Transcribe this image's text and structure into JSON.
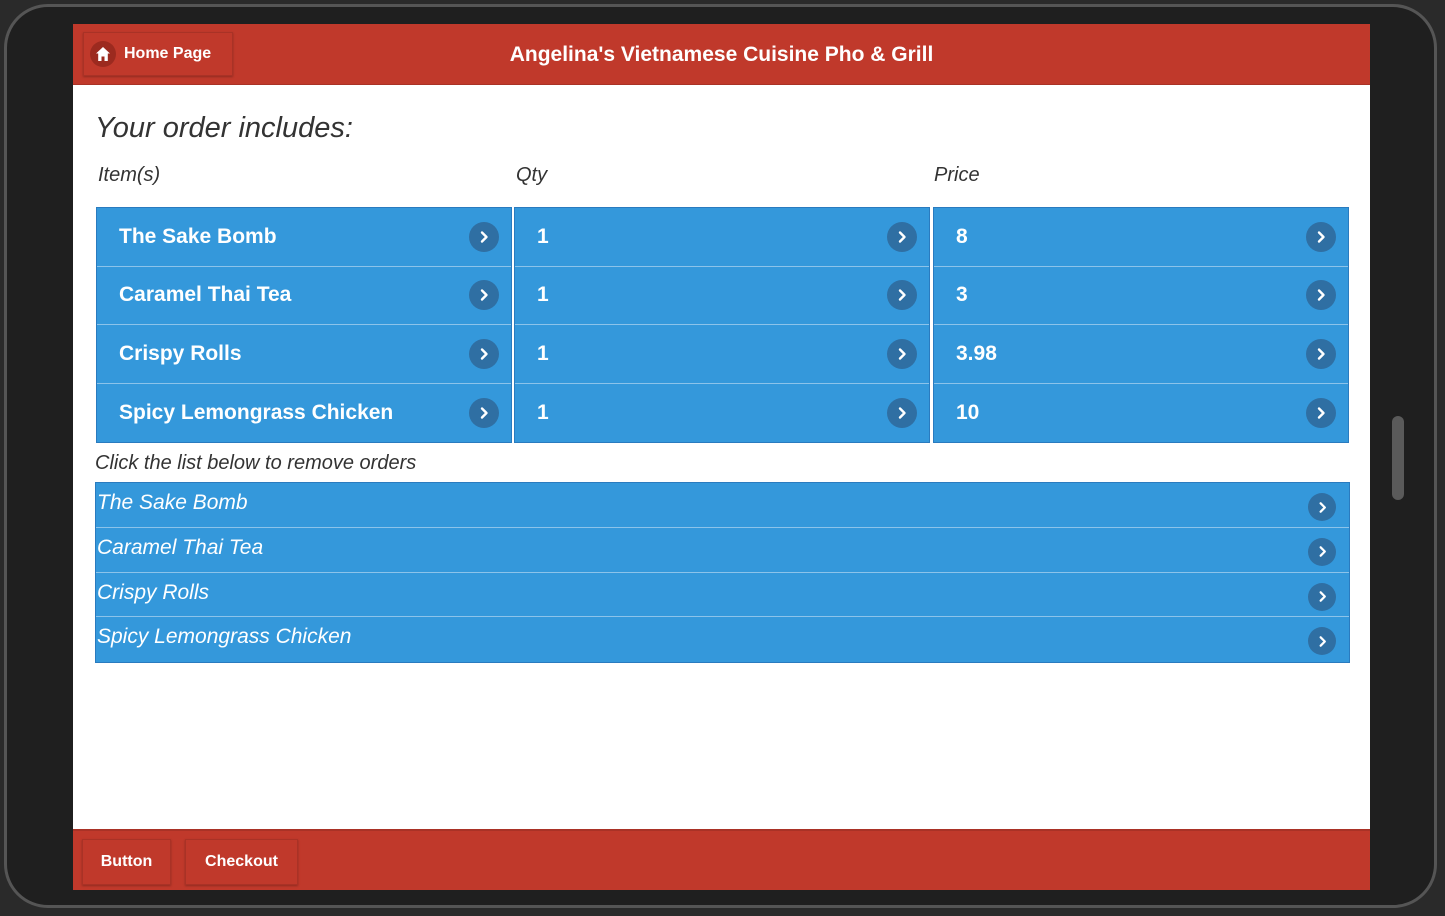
{
  "header": {
    "home_label": "Home Page",
    "title": "Angelina's Vietnamese Cuisine Pho & Grill"
  },
  "order": {
    "heading": "Your order includes:",
    "columns": {
      "item": "Item(s)",
      "qty": "Qty",
      "price": "Price"
    },
    "items": [
      {
        "name": "The Sake Bomb",
        "qty": "1",
        "price": "8"
      },
      {
        "name": "Caramel Thai Tea",
        "qty": "1",
        "price": "3"
      },
      {
        "name": "Crispy Rolls",
        "qty": "1",
        "price": "3.98"
      },
      {
        "name": "Spicy Lemongrass Chicken",
        "qty": "1",
        "price": "10"
      }
    ]
  },
  "remove": {
    "instruction": "Click the list below to remove orders",
    "items": [
      "The Sake Bomb",
      "Caramel Thai Tea",
      "Crispy Rolls",
      "Spicy Lemongrass Chicken"
    ]
  },
  "footer": {
    "button_label": "Button",
    "checkout_label": "Checkout"
  },
  "colors": {
    "brand_red": "#c0392b",
    "list_blue": "#3498db",
    "chevron_blue": "#2f6fa3"
  },
  "icons": {
    "home": "home-icon",
    "chevron": "chevron-right-icon"
  }
}
